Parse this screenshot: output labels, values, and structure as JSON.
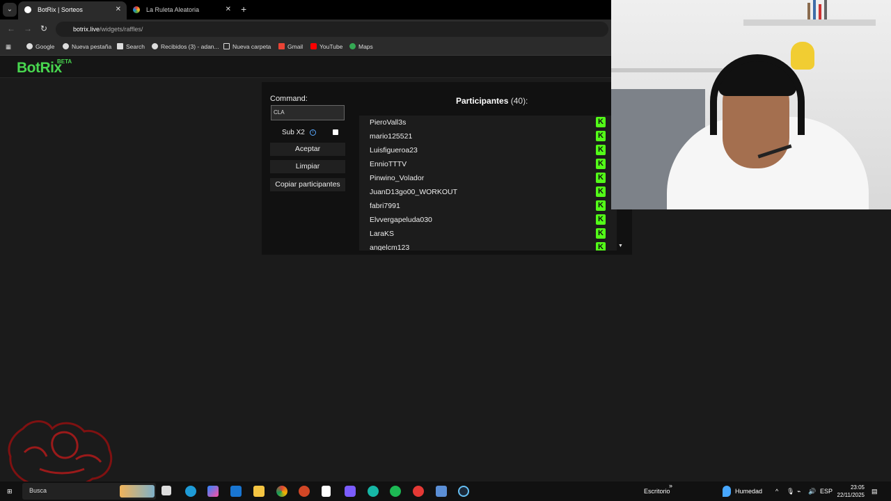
{
  "browser": {
    "tabs": [
      {
        "title": "BotRix | Sorteos",
        "icon": "botrix-icon",
        "active": true
      },
      {
        "title": "La Ruleta Aleatoria",
        "icon": "wheel-icon",
        "active": false
      }
    ],
    "url": {
      "domain": "botrix.live",
      "path": "/widgets/raffles/"
    },
    "bookmarks": [
      "Google",
      "Nueva pestaña",
      "Search",
      "Recibidos (3) - adan...",
      "Nueva carpeta",
      "Gmail",
      "YouTube",
      "Maps"
    ],
    "colors": {
      "accent": "#48d64f",
      "kick": "#53fc18"
    }
  },
  "brand": {
    "logo": "BotRix",
    "badge": "BETA"
  },
  "raffle": {
    "command_label": "Command:",
    "command_value": "CLA",
    "sub_label": "Sub X2",
    "sub_checked": false,
    "buttons": {
      "accept": "Aceptar",
      "clear": "Limpiar",
      "copy": "Copiar participantes"
    },
    "participants_title": "Participantes",
    "participants_count": "(40):",
    "participants": [
      "PieroVall3s",
      "mario125521",
      "Luisfigueroa23",
      "EnnioTTTV",
      "Pinwino_Volador",
      "JuanD13go00_WORKOUT",
      "fabri7991",
      "Elvvergapeluda030",
      "LaraKS",
      "angelcm123"
    ]
  },
  "taskbar": {
    "search_placeholder": "Busca",
    "desktop_label": "Escritorio",
    "weather": "Humedad",
    "language": "ESP",
    "time": "23:05",
    "date": "22/11/2025"
  }
}
